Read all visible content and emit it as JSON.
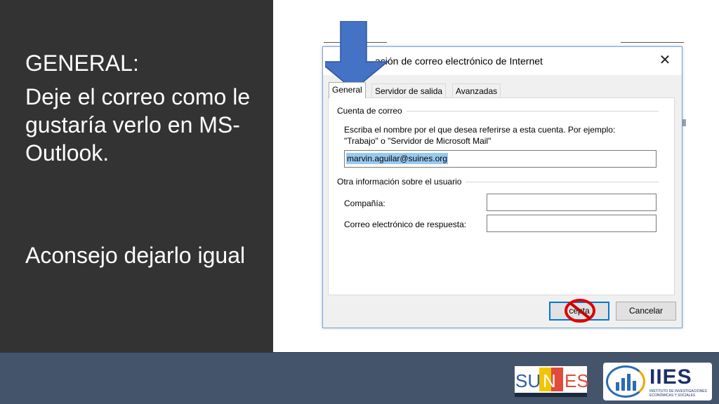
{
  "slide": {
    "heading": "GENERAL:",
    "instruction": "Deje el correo como le gustaría verlo en MS-Outlook.",
    "advice": "Aconsejo dejarlo igual"
  },
  "dialog": {
    "title": "Configuración de correo electrónico de Internet",
    "title_visible": "ación de correo electrónico de Internet",
    "close_icon": "close-x-icon",
    "tabs": [
      {
        "label": "General",
        "active": true
      },
      {
        "label": "Servidor de salida",
        "active": false
      },
      {
        "label": "Avanzadas",
        "active": false
      }
    ],
    "account_group_label": "Cuenta de correo",
    "account_desc_line1": "Escriba el nombre por el que desea referirse a esta cuenta. Por ejemplo:",
    "account_desc_line2": "\"Trabajo\" o \"Servidor de Microsoft Mail\"",
    "account_name_value": "marvin.aguilar@suines.org",
    "user_info_group_label": "Otra información sobre el usuario",
    "company_label": "Compañía:",
    "company_value": "",
    "reply_email_label": "Correo electrónico de respuesta:",
    "reply_email_value": "",
    "ok_button_visible": "cepta",
    "cancel_button": "Cancelar"
  },
  "annotations": {
    "arrow_color": "#4472c4",
    "noentry_color": "#e00000"
  },
  "logos": {
    "suines": {
      "su": "SU",
      "n": "N",
      "es": "ES"
    },
    "iies": {
      "title": "IIES",
      "subtitle": "INSTITUTO DE INVESTIGACIONES ECONÓMICAS Y SOCIALES"
    }
  }
}
